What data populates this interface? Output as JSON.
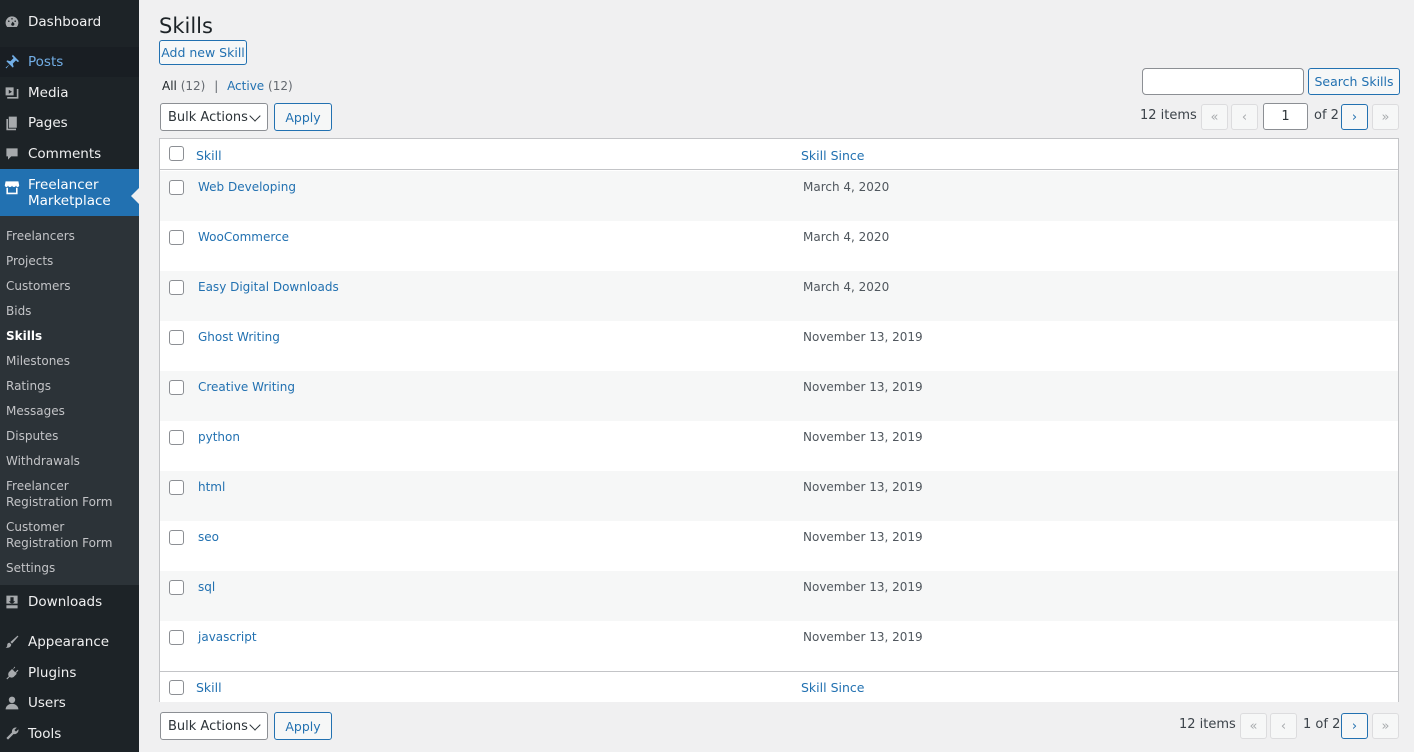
{
  "sidebar": {
    "dashboard": "Dashboard",
    "posts": "Posts",
    "media": "Media",
    "pages": "Pages",
    "comments": "Comments",
    "freelancer_marketplace": "Freelancer Marketplace",
    "submenu": [
      "Freelancers",
      "Projects",
      "Customers",
      "Bids",
      "Skills",
      "Milestones",
      "Ratings",
      "Messages",
      "Disputes",
      "Withdrawals",
      "Freelancer Registration Form",
      "Customer Registration Form",
      "Settings"
    ],
    "downloads": "Downloads",
    "appearance": "Appearance",
    "plugins": "Plugins",
    "users": "Users",
    "tools": "Tools"
  },
  "page": {
    "title": "Skills",
    "add_new": "Add new Skill",
    "filters": {
      "all_label": "All",
      "all_count": "(12)",
      "separator": "|",
      "active_label": "Active",
      "active_count": "(12)"
    },
    "search_button": "Search Skills",
    "search_value": ""
  },
  "top_nav": {
    "bulk_actions": "Bulk Actions",
    "apply": "Apply",
    "items": "12 items",
    "first": "«",
    "prev": "‹",
    "current_page": "1",
    "of_pages": "of 2",
    "next": "›",
    "last": "»"
  },
  "bottom_nav": {
    "bulk_actions": "Bulk Actions",
    "apply": "Apply",
    "items": "12 items",
    "first": "«",
    "prev": "‹",
    "page_info": "1 of 2",
    "next": "›",
    "last": "»"
  },
  "table": {
    "columns": [
      "Skill",
      "Skill Since"
    ],
    "rows": [
      {
        "skill": "Web Developing",
        "since": "March 4, 2020"
      },
      {
        "skill": "WooCommerce",
        "since": "March 4, 2020"
      },
      {
        "skill": "Easy Digital Downloads",
        "since": "March 4, 2020"
      },
      {
        "skill": "Ghost Writing",
        "since": "November 13, 2019"
      },
      {
        "skill": "Creative Writing",
        "since": "November 13, 2019"
      },
      {
        "skill": "python",
        "since": "November 13, 2019"
      },
      {
        "skill": "html",
        "since": "November 13, 2019"
      },
      {
        "skill": "seo",
        "since": "November 13, 2019"
      },
      {
        "skill": "sql",
        "since": "November 13, 2019"
      },
      {
        "skill": "javascript",
        "since": "November 13, 2019"
      }
    ]
  },
  "colors": {
    "sidebar_bg": "#1d2327",
    "submenu_bg": "#2c3338",
    "accent": "#2271b1",
    "page_bg": "#f0f0f1"
  }
}
